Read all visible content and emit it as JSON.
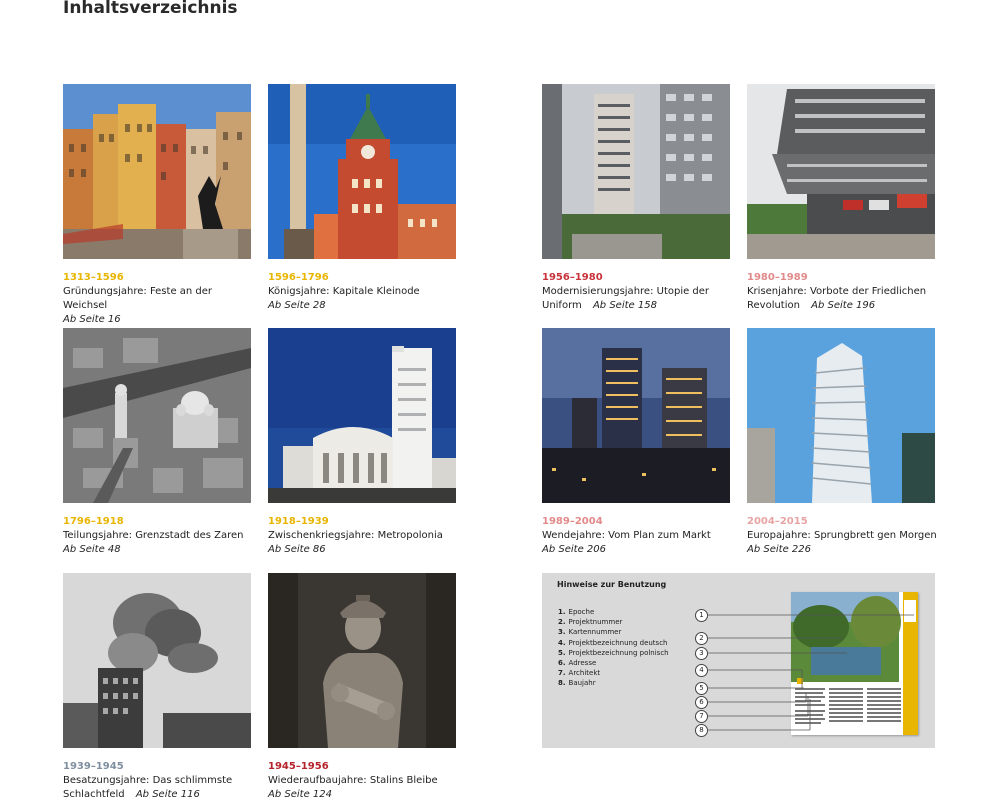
{
  "page_title": "Inhaltsverzeichnis",
  "colors": {
    "gold": "#e8b500",
    "red": "#c8333a",
    "pink": "#e28a8a",
    "light_pink": "#e6a4a4",
    "gray_blue": "#7f8fa0",
    "crimson": "#b5232b"
  },
  "entries": [
    {
      "years": "1313–1596",
      "title": "Gründungsjahre: Feste an der Weichsel",
      "page": "Ab Seite 16",
      "image": "old-town-market-square-mermaid"
    },
    {
      "years": "1596–1796",
      "title": "Königsjahre: Kapitale Kleinode",
      "page": "Ab Seite 28",
      "image": "royal-castle-column"
    },
    {
      "years": "1956–1980",
      "title": "Modernisierungsjahre: Utopie der Uniform",
      "page": "Ab Seite 158",
      "image": "highrise-housing-blocks"
    },
    {
      "years": "1980–1989",
      "title": "Krisenjahre: Vorbote der Friedlichen Revolution",
      "page": "Ab Seite 196",
      "image": "brutalist-building"
    },
    {
      "years": "1796–1918",
      "title": "Teilungsjahre: Grenzstadt des Zaren",
      "page": "Ab Seite 48",
      "image": "aerial-city-cathedral"
    },
    {
      "years": "1918–1939",
      "title": "Zwischenkriegsjahre: Metropolonia",
      "page": "Ab Seite 86",
      "image": "white-modernist-tower"
    },
    {
      "years": "1989–2004",
      "title": "Wendejahre: Vom Plan zum Markt",
      "page": "Ab Seite 206",
      "image": "skyscrapers-dusk"
    },
    {
      "years": "2004–2015",
      "title": "Europajahre: Sprungbrett gen Morgen",
      "page": "Ab Seite 226",
      "image": "twisted-tower"
    },
    {
      "years": "1939–1945",
      "title": "Besatzungsjahre: Das schlimmste Schlachtfeld",
      "page": "Ab Seite 116",
      "image": "bombed-building-smoke"
    },
    {
      "years": "1945–1956",
      "title": "Wiederaufbaujahre: Stalins Bleibe",
      "page": "Ab Seite 124",
      "image": "socialist-realist-sculpture"
    }
  ],
  "help": {
    "heading": "Hinweise zur Benutzung",
    "items": [
      {
        "num": "1.",
        "label": "Epoche"
      },
      {
        "num": "2.",
        "label": "Projektnummer"
      },
      {
        "num": "3.",
        "label": "Kartennummer"
      },
      {
        "num": "4.",
        "label": "Projektbezeichnung deutsch"
      },
      {
        "num": "5.",
        "label": "Projektbezeichnung polnisch"
      },
      {
        "num": "6.",
        "label": "Adresse"
      },
      {
        "num": "7.",
        "label": "Architekt"
      },
      {
        "num": "8.",
        "label": "Baujahr"
      }
    ],
    "callouts": [
      "1",
      "2",
      "3",
      "4",
      "5",
      "6",
      "7",
      "8"
    ]
  }
}
